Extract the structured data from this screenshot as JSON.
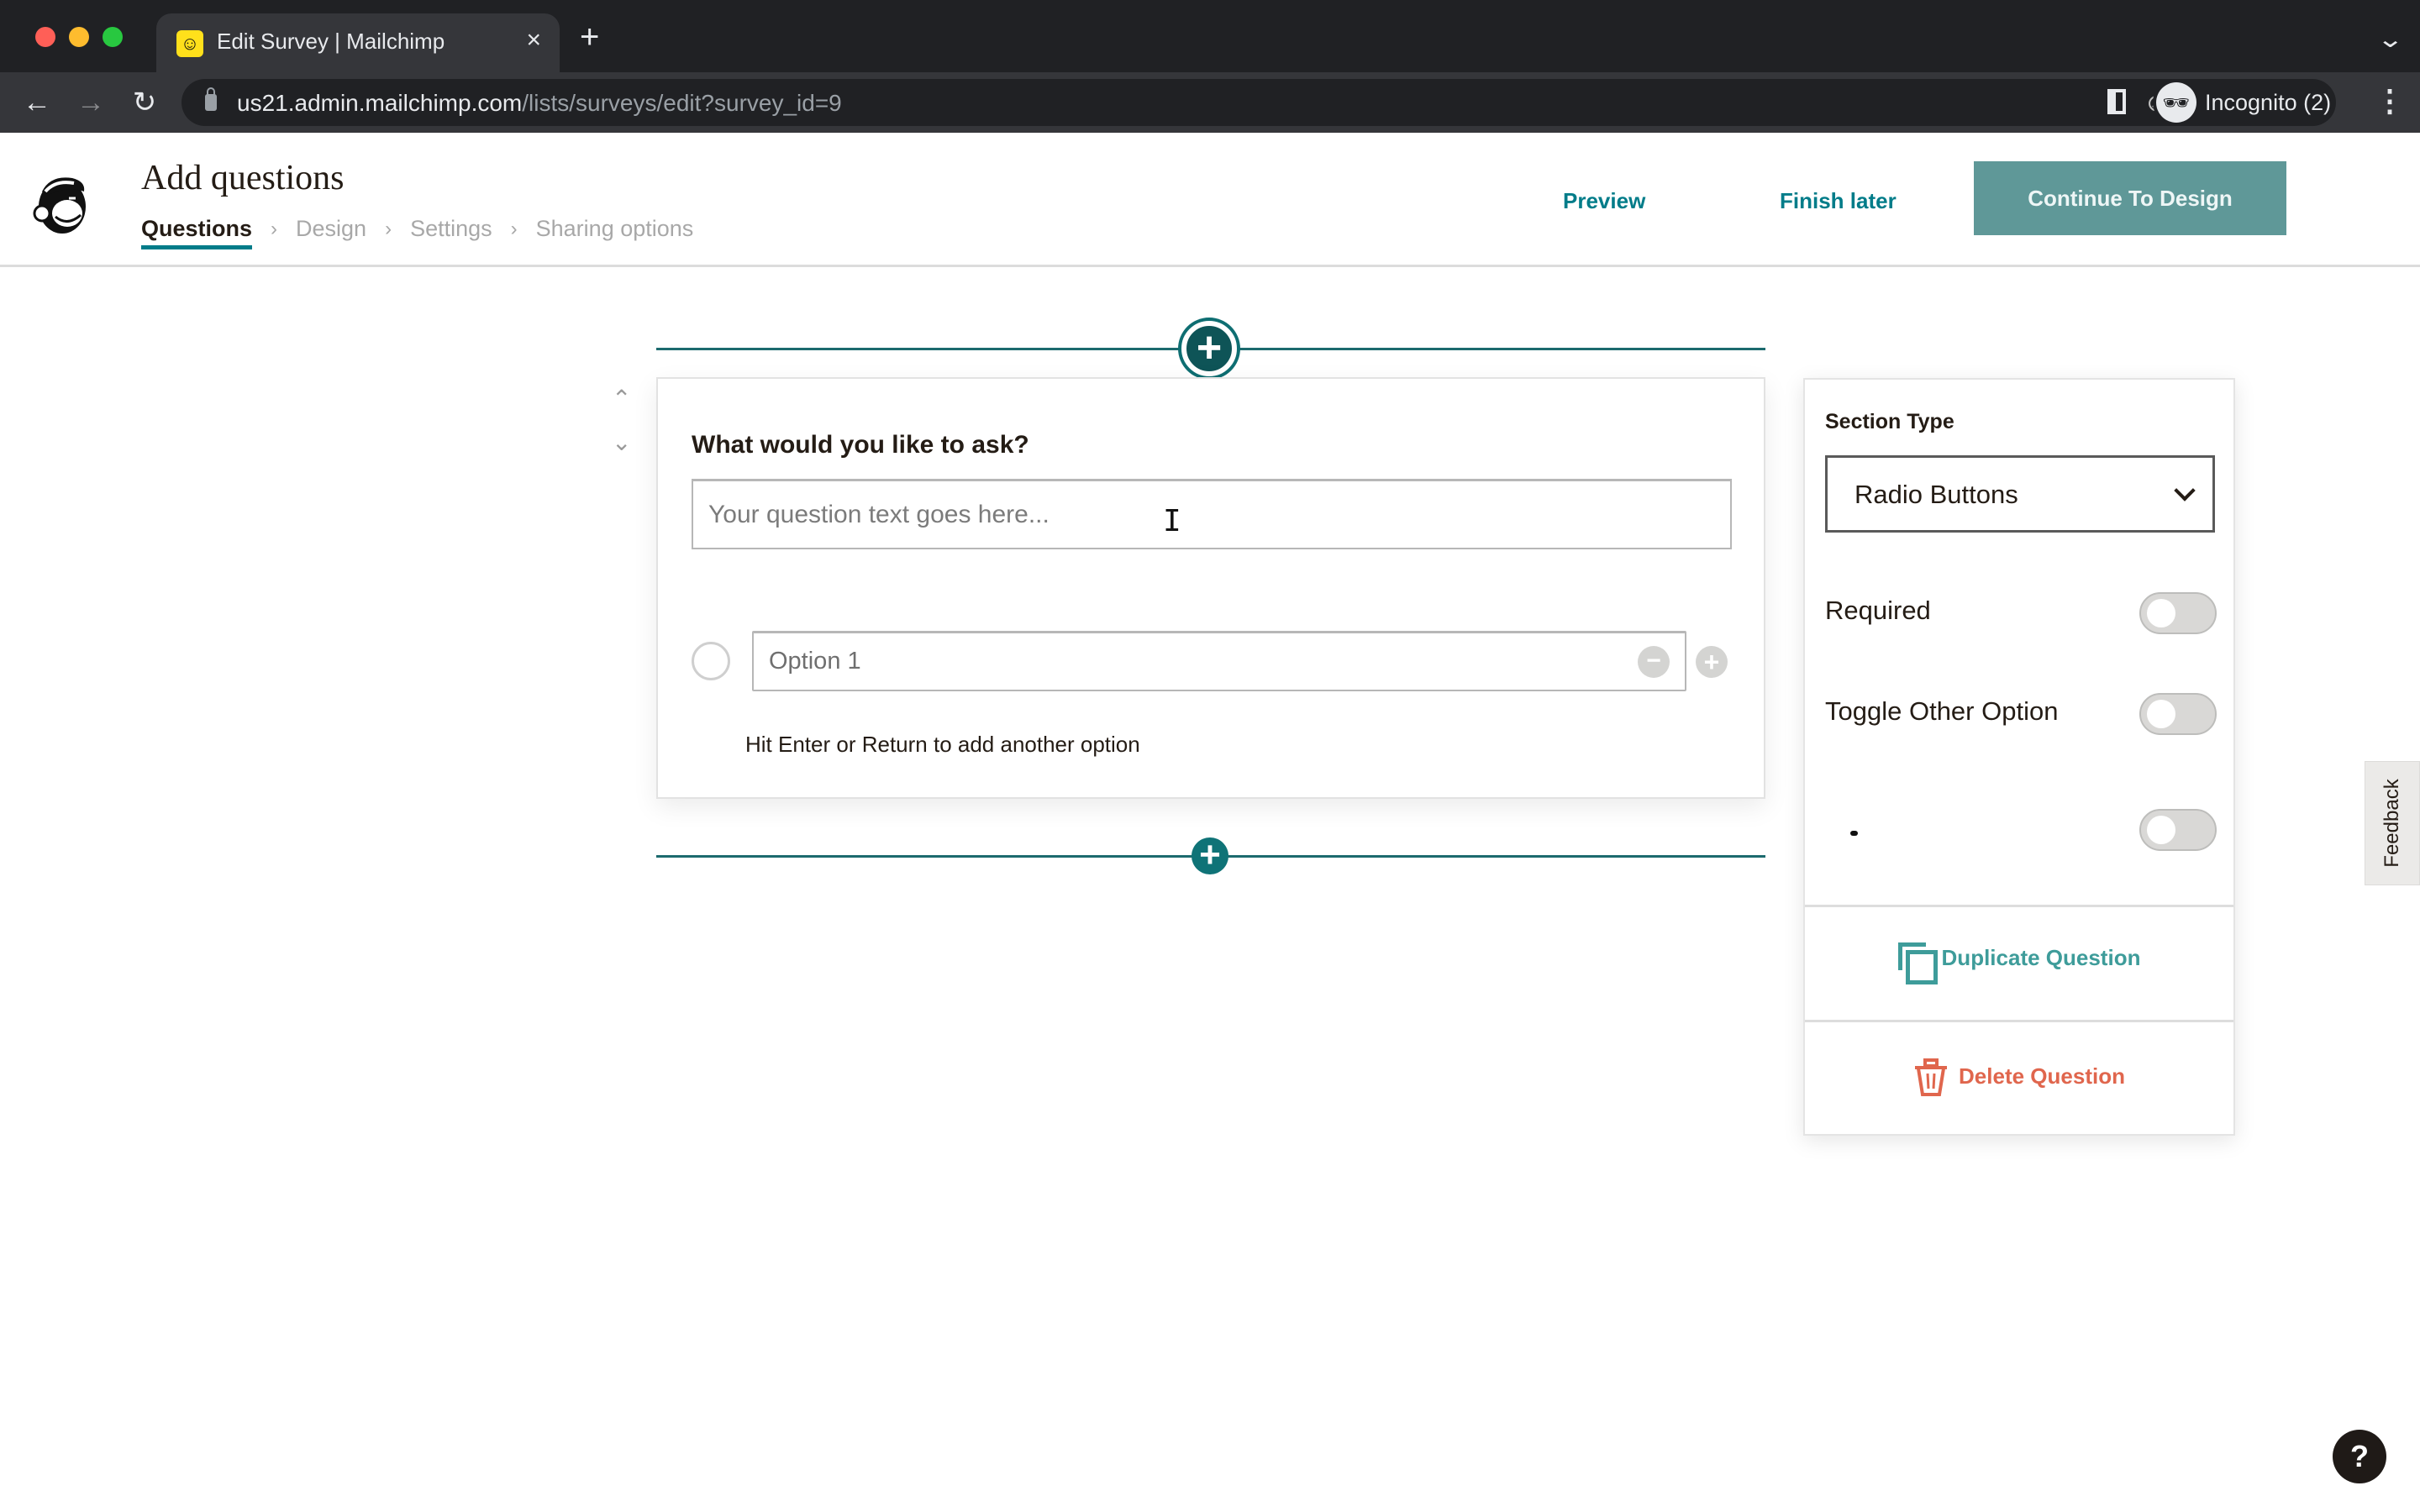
{
  "browser": {
    "tab": {
      "title": "Edit Survey | Mailchimp",
      "favicon": "mailchimp-favicon"
    },
    "new_tab_label": "+",
    "url": {
      "host": "us21.admin.mailchimp.com",
      "path": "/lists/surveys/edit?survey_id=9"
    },
    "profile_label": "Incognito (2)",
    "icons": {
      "back": "←",
      "forward": "→",
      "reload": "↻",
      "close_tab": "×",
      "tab_search": "⌄",
      "eye_off": "⊘",
      "star": "☆",
      "menu": "⋮",
      "incognito": "🕶"
    }
  },
  "header": {
    "title": "Add questions",
    "steps": [
      {
        "label": "Questions",
        "active": true
      },
      {
        "label": "Design",
        "active": false
      },
      {
        "label": "Settings",
        "active": false
      },
      {
        "label": "Sharing options",
        "active": false
      }
    ],
    "step_separator": "›",
    "preview_label": "Preview",
    "finish_later_label": "Finish later",
    "continue_label": "Continue To Design"
  },
  "question": {
    "label": "What would you like to ask?",
    "input_value": "",
    "input_placeholder": "Your question text goes here...",
    "options": [
      {
        "value": "",
        "placeholder": "Option 1"
      }
    ],
    "hint": "Hit Enter or Return to add another option",
    "add_icon": "+",
    "remove_icon": "−",
    "reorder_up": "⌃",
    "reorder_down": "⌄"
  },
  "side_panel": {
    "section_type_label": "Section Type",
    "section_type_value": "Radio Buttons",
    "toggles": [
      {
        "label": "Required",
        "on": false
      },
      {
        "label": "Toggle Other Option",
        "on": false
      },
      {
        "label": "",
        "on": false
      }
    ],
    "duplicate_label": "Duplicate Question",
    "delete_label": "Delete Question"
  },
  "feedback_label": "Feedback",
  "help_label": "?",
  "colors": {
    "brand_teal": "#007c89",
    "continue_button": "#5f9898",
    "add_button": "#0e5457",
    "delete_red": "#e0664d",
    "duplicate_teal": "#3e9c9a"
  }
}
